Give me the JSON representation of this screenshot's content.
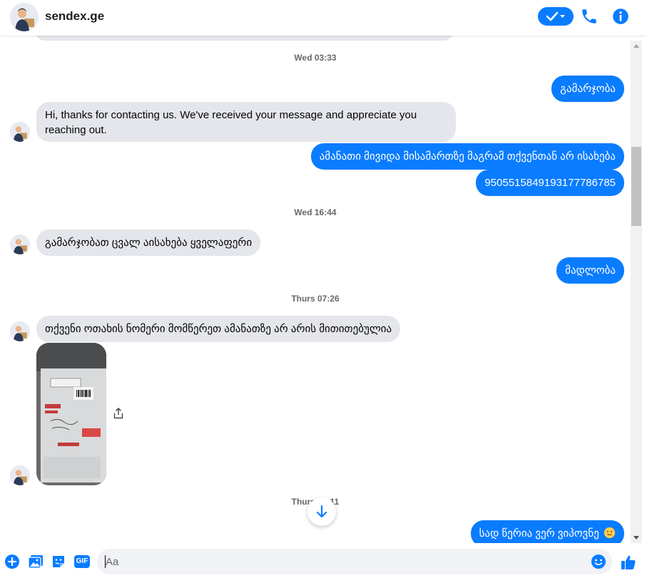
{
  "header": {
    "page_name": "sendex.ge",
    "avatar_icon": "courier-avatar-icon",
    "check_button_icon": "checkmark-dropdown-icon",
    "call_icon": "phone-icon",
    "info_icon": "info-icon"
  },
  "conversation": {
    "timestamps": [
      "Wed 03:33",
      "Wed 16:44",
      "Thurs 07:26",
      "Thurs 10:11"
    ],
    "messages": [
      {
        "direction": "outgoing",
        "text": "გამარჯობა"
      },
      {
        "direction": "incoming",
        "text_line1": "Hi, thanks for contacting us. We've received your message and appreciate you",
        "text_line2": "reaching out."
      },
      {
        "direction": "outgoing",
        "text": "ამანათი მივიდა მისამართზე მაგრამ თქვენთან არ ისახება"
      },
      {
        "direction": "outgoing",
        "text": "9505515849193177786785"
      },
      {
        "direction": "incoming",
        "text": "გამარჯობათ ცვალ აისახება ყველაფერი"
      },
      {
        "direction": "outgoing",
        "text": "მადლობა"
      },
      {
        "direction": "incoming",
        "text": "თქვენი ოთახის ნომერი მომწერეთ ამანათზე არ არის მითითებულია"
      },
      {
        "direction": "incoming",
        "type": "photo",
        "icon": "package-photo"
      },
      {
        "direction": "outgoing",
        "text": "სად წერია ვერ ვიპოვნე",
        "emoji": "slightly-smiling-face-emoji"
      }
    ],
    "share_icon": "share-icon",
    "scroll_down_icon": "arrow-down-icon"
  },
  "composer": {
    "placeholder": "Aa",
    "value": "",
    "icons": [
      "plus-circle-icon",
      "image-icon",
      "sticker-icon",
      "gif-icon",
      "emoji-icon",
      "thumbs-up-icon"
    ],
    "gif_label": "GIF"
  },
  "colors": {
    "accent": "#0a7cff",
    "incoming_bubble": "#e4e6eb",
    "timestamp": "#65676b"
  }
}
